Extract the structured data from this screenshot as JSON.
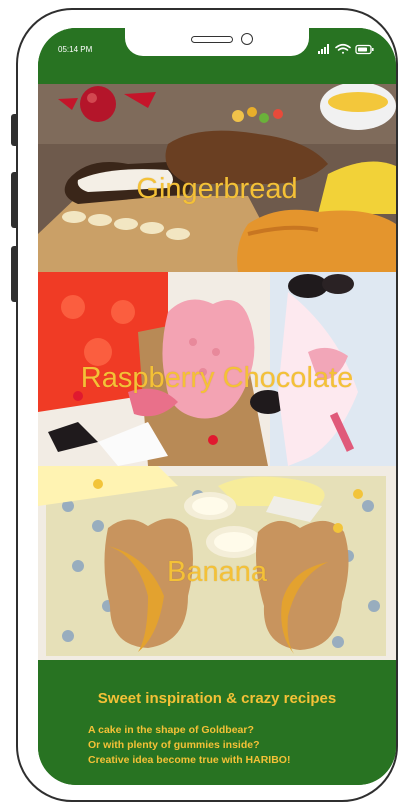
{
  "status": {
    "time": "05:14 PM"
  },
  "recipes": [
    {
      "title": "Gingerbread"
    },
    {
      "title": "Raspberry Chocolate"
    },
    {
      "title": "Banana"
    }
  ],
  "footer": {
    "title": "Sweet inspiration & crazy recipes",
    "lines": [
      "A cake in the shape of Goldbear?",
      "Or with plenty of gummies inside?",
      "Creative idea become true with HARIBO!"
    ]
  },
  "colors": {
    "brand_green": "#287322",
    "accent_yellow": "#f4c137"
  }
}
